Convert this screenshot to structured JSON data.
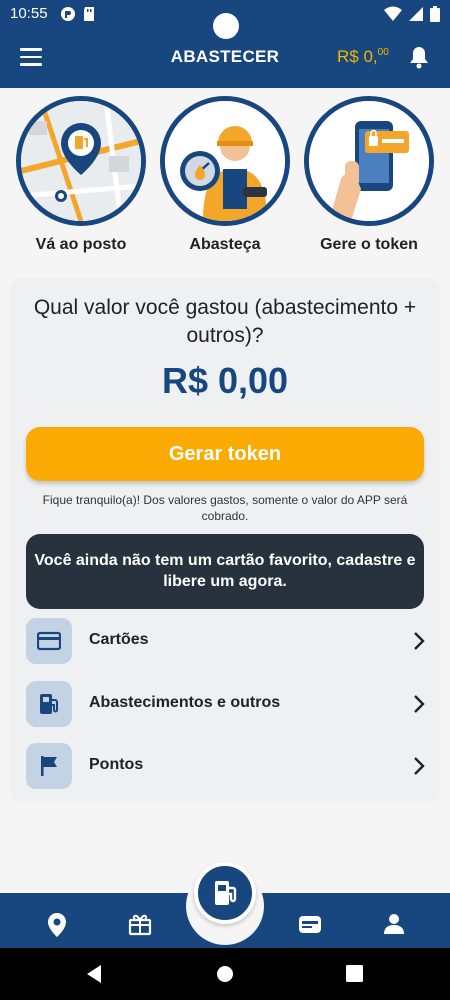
{
  "status": {
    "time": "10:55"
  },
  "header": {
    "title": "ABASTECER",
    "balance_main": "R$ 0,",
    "balance_cents": "00"
  },
  "steps": [
    {
      "label": "Vá ao posto",
      "icon": "map-pin-illustration"
    },
    {
      "label": "Abasteça",
      "icon": "attendant-illustration"
    },
    {
      "label": "Gere o token",
      "icon": "phone-token-illustration"
    }
  ],
  "main": {
    "question": "Qual valor você gastou (abastecimento + outros)?",
    "amount": "R$ 0,00",
    "token_button": "Gerar token",
    "note": "Fique tranquilo(a)! Dos valores gastos, somente o valor do APP será cobrado.",
    "banner": "Você ainda não tem um cartão favorito, cadastre e libere um agora."
  },
  "menu": [
    {
      "label": "Cartões",
      "icon": "card-icon"
    },
    {
      "label": "Abastecimentos e outros",
      "icon": "fuel-pump-icon"
    },
    {
      "label": "Pontos",
      "icon": "flag-icon"
    }
  ],
  "bottom_nav": [
    "location-icon",
    "gift-icon",
    "fuel-pump-icon",
    "wallet-icon",
    "person-icon"
  ],
  "colors": {
    "primary": "#18467e",
    "accent": "#fbaa04",
    "banner": "#28323f"
  }
}
